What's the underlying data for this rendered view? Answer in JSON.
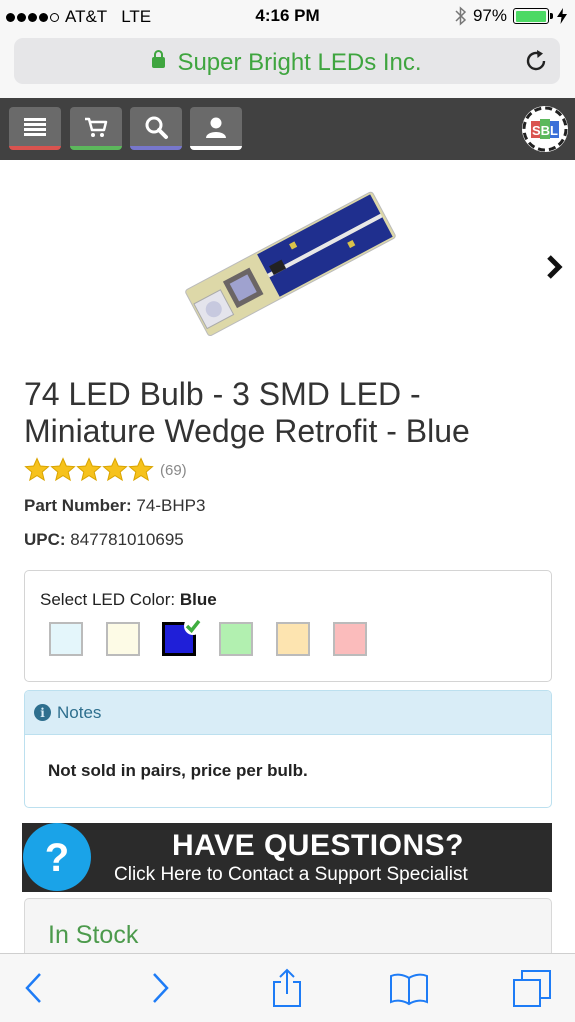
{
  "status_bar": {
    "carrier": "AT&T",
    "network": "LTE",
    "time": "4:16 PM",
    "battery_percent": "97%",
    "battery_level": 0.97
  },
  "browser": {
    "url_title": "Super Bright LEDs Inc."
  },
  "nav": {
    "items": [
      {
        "name": "menu-icon",
        "color": "#d9534f"
      },
      {
        "name": "cart-icon",
        "color": "#5cb85c"
      },
      {
        "name": "search-icon",
        "color": "#7777cc"
      },
      {
        "name": "user-icon",
        "color": "#ffffff"
      }
    ],
    "logo_text": "SBL"
  },
  "product": {
    "title": "74 LED Bulb - 3 SMD LED - Miniature Wedge Retrofit - Blue",
    "rating": 5,
    "review_count": "(69)",
    "part_number_label": "Part Number:",
    "part_number": "74-BHP3",
    "upc_label": "UPC:",
    "upc": "847781010695"
  },
  "color_select": {
    "label": "Select LED Color:",
    "selected": "Blue",
    "swatches": [
      {
        "color": "#e4f6fb"
      },
      {
        "color": "#fdfbe6"
      },
      {
        "color": "#1f1fd8",
        "selected": true
      },
      {
        "color": "#b2f0b0"
      },
      {
        "color": "#fde4b0"
      },
      {
        "color": "#fbbcbc"
      }
    ]
  },
  "notes": {
    "header": "Notes",
    "body": "Not sold in pairs, price per bulb."
  },
  "banner": {
    "title": "HAVE QUESTIONS?",
    "subtitle": "Click Here to Contact a Support Specialist"
  },
  "stock": {
    "status": "In Stock"
  },
  "toolbar": {
    "accent": "#1e7cf6"
  }
}
